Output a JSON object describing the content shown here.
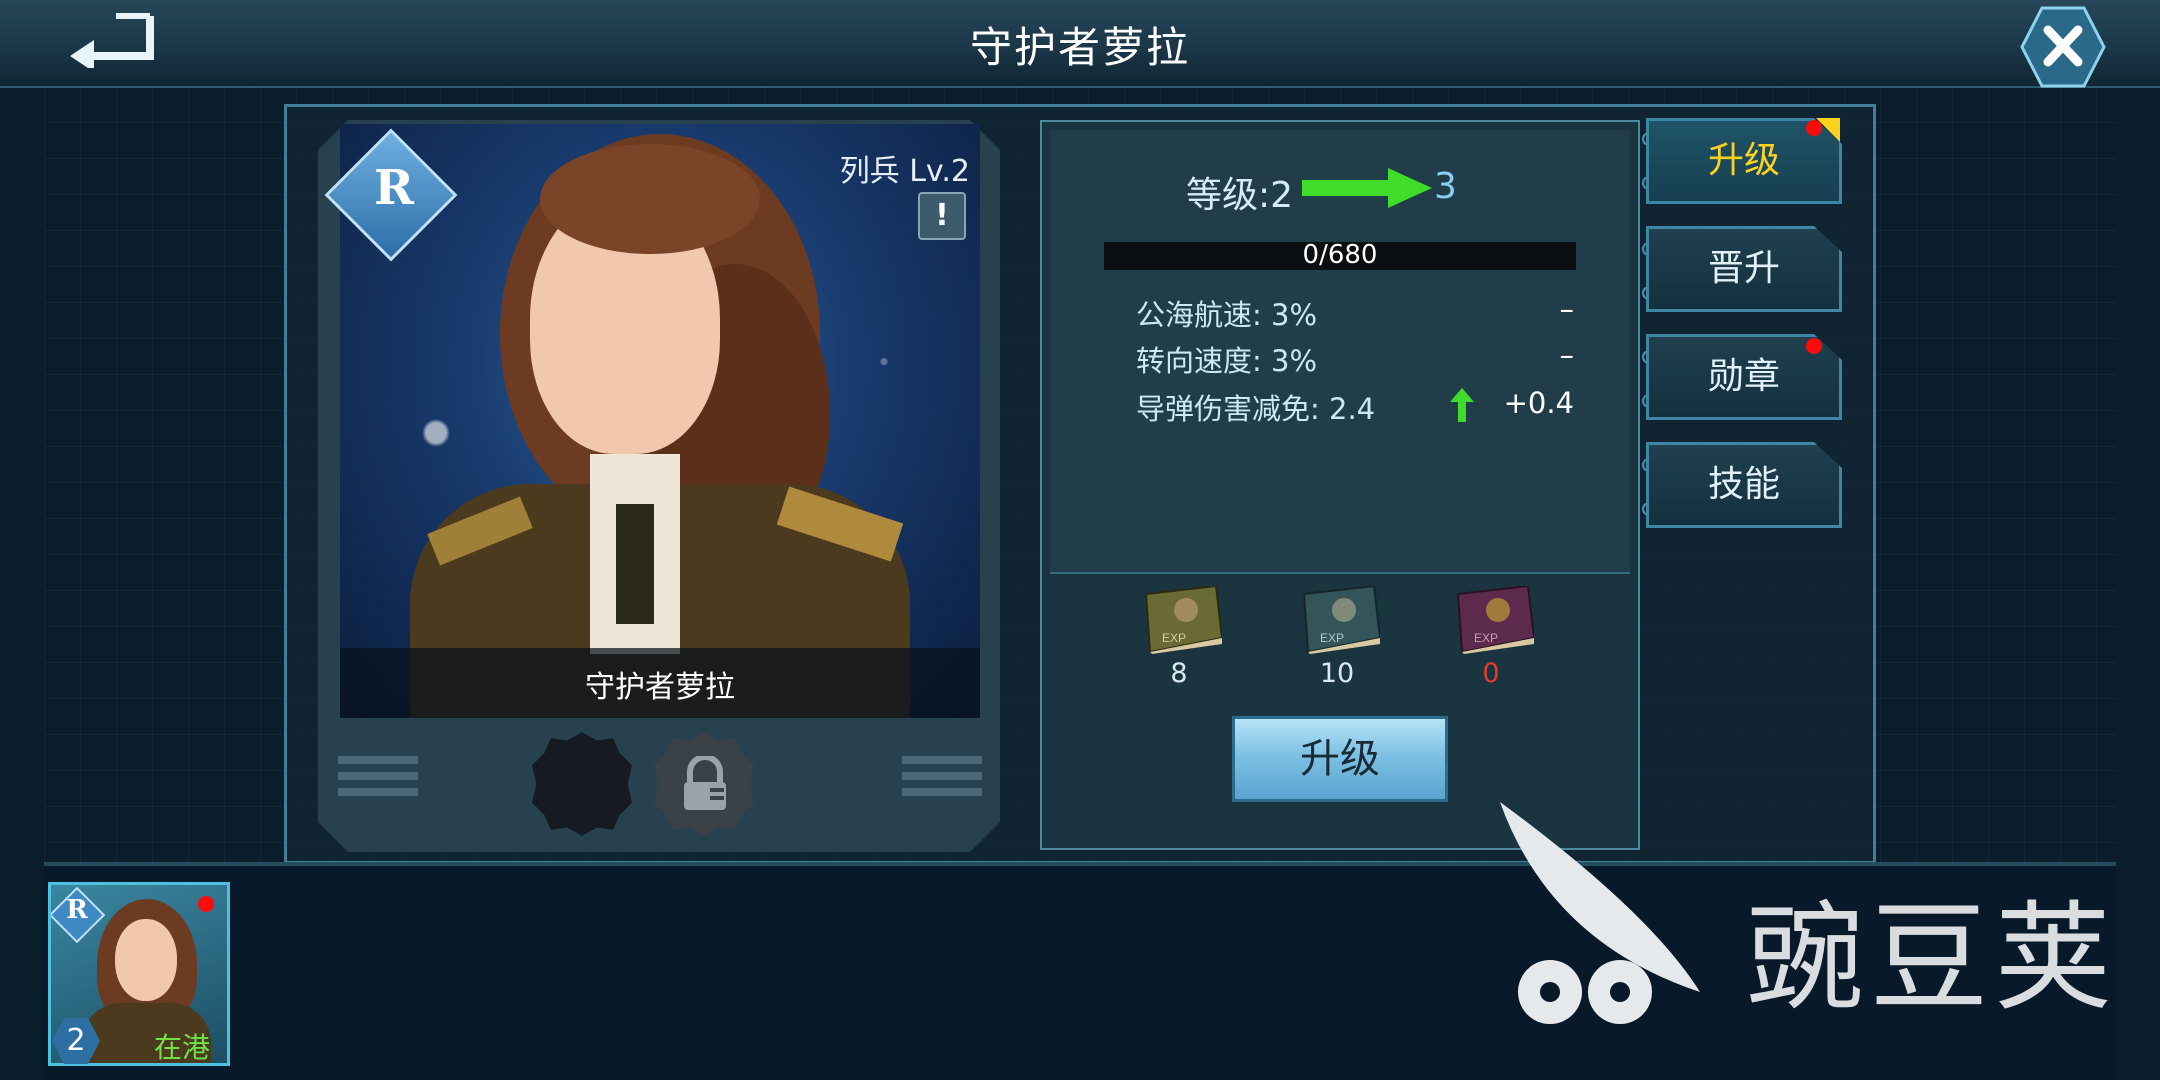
{
  "header": {
    "title": "守护者萝拉",
    "back_icon": "back-arrow-icon",
    "close_icon": "close-x-icon"
  },
  "portrait": {
    "rarity": "R",
    "rank_level": "列兵 Lv.2",
    "name": "守护者萝拉",
    "info_label": "!"
  },
  "stats": {
    "level_label": "等级:2",
    "level_next": "3",
    "exp_text": "0/680",
    "exp_progress": 0,
    "rows": [
      {
        "label": "公海航速: 3%",
        "delta": "–"
      },
      {
        "label": "转向速度: 3%",
        "delta": "–"
      },
      {
        "label": "导弹伤害减免: 2.4",
        "delta": "+0.4"
      }
    ]
  },
  "exp_items": [
    {
      "count": "8",
      "color": "#6a6a34",
      "count_color": "#dbe9f0"
    },
    {
      "count": "10",
      "color": "#33555a",
      "count_color": "#dbe9f0"
    },
    {
      "count": "0",
      "color": "#5b2a4c",
      "count_color": "#e53a2c"
    }
  ],
  "upgrade_button": "升级",
  "tabs": [
    {
      "label": "升级",
      "active": true,
      "badge": true
    },
    {
      "label": "晋升",
      "active": false,
      "badge": false
    },
    {
      "label": "勋章",
      "active": false,
      "badge": true
    },
    {
      "label": "技能",
      "active": false,
      "badge": false
    }
  ],
  "roster": {
    "rarity": "R",
    "level": "2",
    "status": "在港"
  },
  "watermark": "豌豆荚",
  "colors": {
    "accent": "#4c8aa2",
    "active_tab_text": "#ffd21e",
    "badge_red": "#ff0a0a",
    "arrow_green": "#3fdc2a",
    "status_green": "#6fe24a"
  }
}
